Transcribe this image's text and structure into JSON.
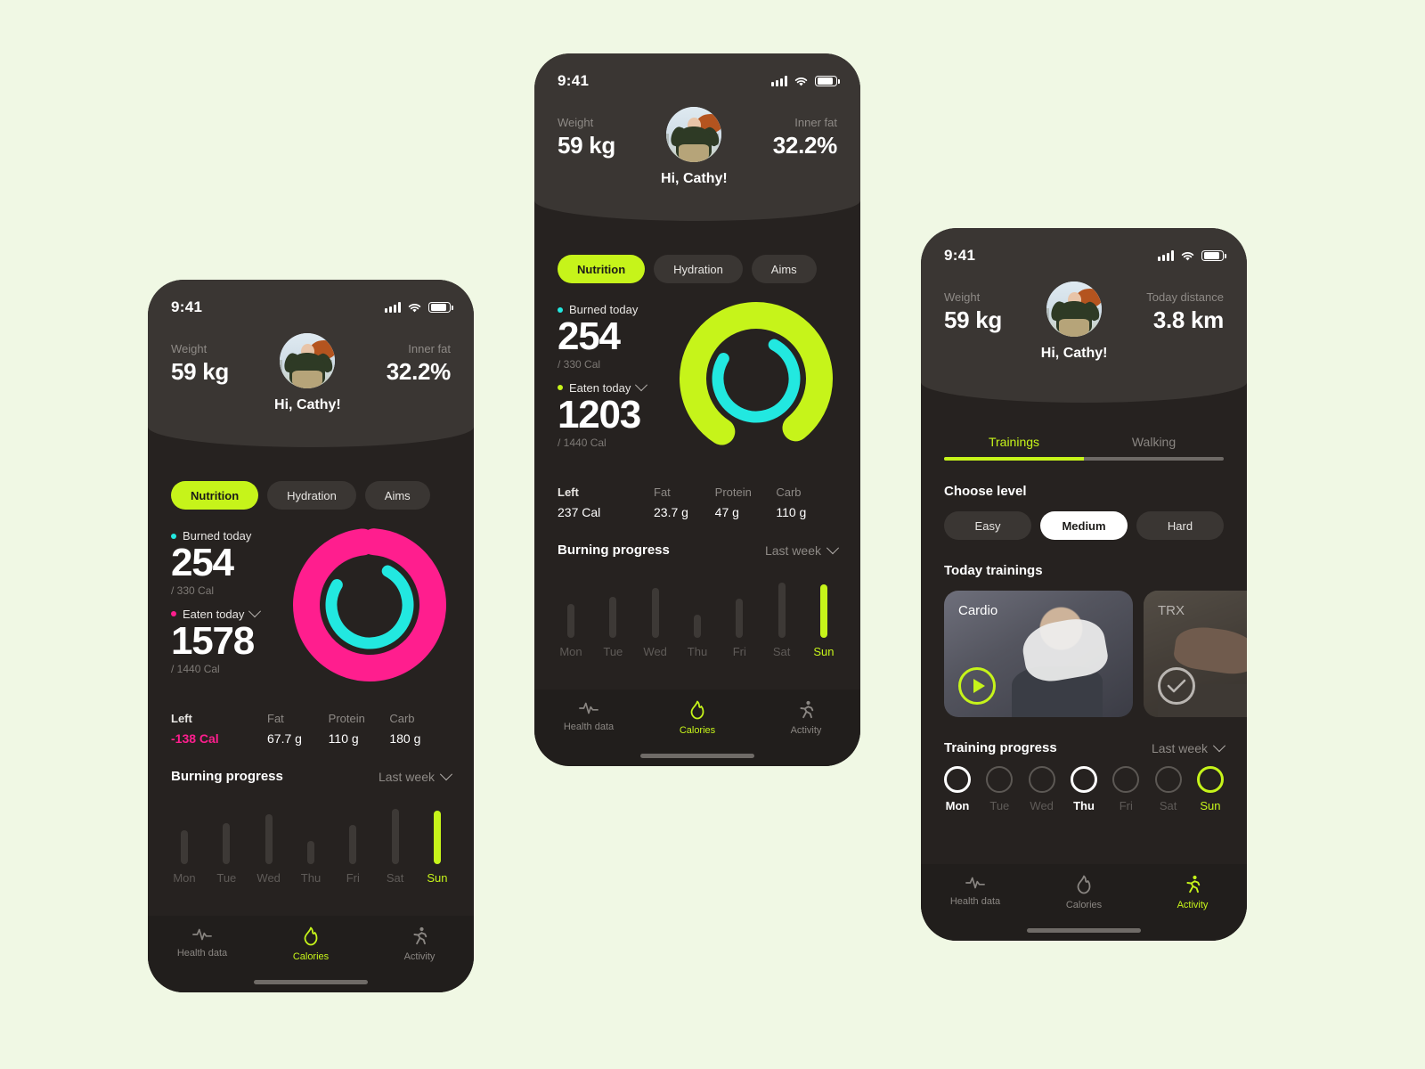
{
  "theme": {
    "page_bg": "#f0f8e4",
    "phone_bg": "#262220",
    "header_bg": "#3a3633",
    "lime": "#c6f41a",
    "pink": "#ff1e8e",
    "cyan": "#22e8e0",
    "muted": "#8e8a86"
  },
  "status": {
    "time": "9:41",
    "signal_icon": "signal-bars-icon",
    "wifi_icon": "wifi-icon",
    "battery_icon": "battery-icon"
  },
  "profile": {
    "greeting": "Hi, Cathy!",
    "avatar_icon": "avatar"
  },
  "phone1": {
    "hero": {
      "left_label": "Weight",
      "left_value": "59 kg",
      "right_label": "Inner fat",
      "right_value": "32.2%"
    },
    "tabs": [
      {
        "label": "Nutrition",
        "active": true
      },
      {
        "label": "Hydration",
        "active": false
      },
      {
        "label": "Aims",
        "active": false
      }
    ],
    "calories": {
      "burned_label": "Burned today",
      "burned_value": "254",
      "burned_goal": "/ 330 Cal",
      "eaten_label": "Eaten today",
      "eaten_value": "1578",
      "eaten_goal": "/ 1440 Cal",
      "burned_dot_color": "#22e8e0",
      "eaten_dot_color": "#ff1e8e",
      "ring_outer_color": "#ff1e8e",
      "ring_inner_color": "#22e8e0",
      "ring_outer_pct": 97,
      "ring_inner_pct": 76
    },
    "macros": [
      {
        "label": "Left",
        "value": "-138 Cal",
        "emphasis": true,
        "color": "#ff1e8e"
      },
      {
        "label": "Fat",
        "value": "67.7 g"
      },
      {
        "label": "Protein",
        "value": "110 g"
      },
      {
        "label": "Carb",
        "value": "180 g"
      }
    ],
    "chart_data": {
      "type": "bar",
      "title": "Burning progress",
      "selector": "Last week",
      "categories": [
        "Mon",
        "Tue",
        "Wed",
        "Thu",
        "Fri",
        "Sat",
        "Sun"
      ],
      "values": [
        38,
        46,
        56,
        26,
        44,
        62,
        60
      ],
      "highlight_index": 6,
      "xlabel": "",
      "ylabel": "",
      "ylim": [
        0,
        78
      ],
      "grid": false
    },
    "nav": [
      {
        "label": "Health data",
        "icon": "heartbeat-icon",
        "active": false
      },
      {
        "label": "Calories",
        "icon": "flame-icon",
        "active": true
      },
      {
        "label": "Activity",
        "icon": "runner-icon",
        "active": false
      }
    ]
  },
  "phone2": {
    "hero": {
      "left_label": "Weight",
      "left_value": "59 kg",
      "right_label": "Inner fat",
      "right_value": "32.2%"
    },
    "tabs": [
      {
        "label": "Nutrition",
        "active": true
      },
      {
        "label": "Hydration",
        "active": false
      },
      {
        "label": "Aims",
        "active": false
      }
    ],
    "calories": {
      "burned_label": "Burned today",
      "burned_value": "254",
      "burned_goal": "/ 330 Cal",
      "eaten_label": "Eaten today",
      "eaten_value": "1203",
      "eaten_goal": "/ 1440 Cal",
      "burned_dot_color": "#22e8e0",
      "eaten_dot_color": "#c6f41a",
      "ring_outer_color": "#c6f41a",
      "ring_inner_color": "#22e8e0",
      "ring_outer_pct": 80,
      "ring_inner_pct": 76
    },
    "macros": [
      {
        "label": "Left",
        "value": "237 Cal",
        "emphasis": true,
        "color": "#ffffff"
      },
      {
        "label": "Fat",
        "value": "23.7 g"
      },
      {
        "label": "Protein",
        "value": "47 g"
      },
      {
        "label": "Carb",
        "value": "110 g"
      }
    ],
    "chart_data": {
      "type": "bar",
      "title": "Burning progress",
      "selector": "Last week",
      "categories": [
        "Mon",
        "Tue",
        "Wed",
        "Thu",
        "Fri",
        "Sat",
        "Sun"
      ],
      "values": [
        38,
        46,
        56,
        26,
        44,
        62,
        60
      ],
      "highlight_index": 6,
      "xlabel": "",
      "ylabel": "",
      "ylim": [
        0,
        78
      ],
      "grid": false
    },
    "nav": [
      {
        "label": "Health data",
        "icon": "heartbeat-icon",
        "active": false
      },
      {
        "label": "Calories",
        "icon": "flame-icon",
        "active": true
      },
      {
        "label": "Activity",
        "icon": "runner-icon",
        "active": false
      }
    ]
  },
  "phone3": {
    "hero": {
      "left_label": "Weight",
      "left_value": "59 kg",
      "right_label": "Today distance",
      "right_value": "3.8 km"
    },
    "segments": [
      {
        "label": "Trainings",
        "active": true
      },
      {
        "label": "Walking",
        "active": false
      }
    ],
    "level_title": "Choose level",
    "levels": [
      {
        "label": "Easy",
        "active": false
      },
      {
        "label": "Medium",
        "active": true
      },
      {
        "label": "Hard",
        "active": false
      }
    ],
    "trainings_title": "Today trainings",
    "trainings": [
      {
        "title": "Cardio",
        "state": "play",
        "icon": "play-icon"
      },
      {
        "title": "TRX",
        "state": "done",
        "icon": "check-icon"
      }
    ],
    "chart_data": {
      "type": "bar",
      "title": "Training progress",
      "selector": "Last week",
      "categories": [
        "Mon",
        "Tue",
        "Wed",
        "Thu",
        "Fri",
        "Sat",
        "Sun"
      ],
      "values": [
        1,
        0,
        0,
        1,
        0,
        0,
        1
      ],
      "states": [
        "done",
        "empty",
        "empty",
        "done",
        "empty",
        "empty",
        "today"
      ],
      "xlabel": "",
      "ylabel": "",
      "ylim": [
        0,
        1
      ],
      "grid": false
    },
    "nav": [
      {
        "label": "Health data",
        "icon": "heartbeat-icon",
        "active": false
      },
      {
        "label": "Calories",
        "icon": "flame-icon",
        "active": false
      },
      {
        "label": "Activity",
        "icon": "runner-icon",
        "active": true
      }
    ]
  }
}
